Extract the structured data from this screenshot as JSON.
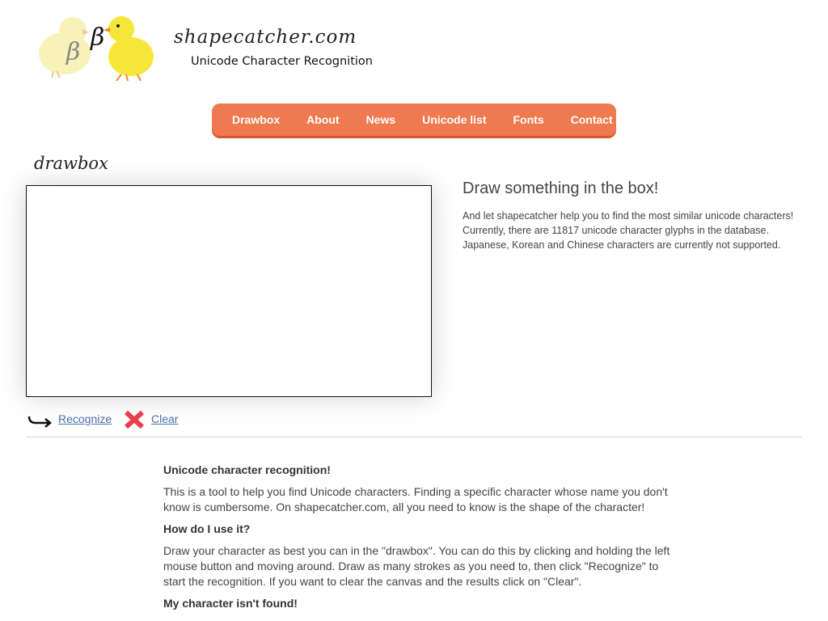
{
  "header": {
    "site_name": "shapecatcher.com",
    "tagline": "Unicode Character Recognition",
    "logo_glyph_left": "β",
    "logo_glyph_right": "β"
  },
  "nav": {
    "items": [
      {
        "label": "Drawbox"
      },
      {
        "label": "About"
      },
      {
        "label": "News"
      },
      {
        "label": "Unicode list"
      },
      {
        "label": "Fonts"
      },
      {
        "label": "Contact"
      }
    ],
    "color": "#f07a50"
  },
  "drawbox": {
    "title": "drawbox",
    "recognize_label": "Recognize",
    "clear_label": "Clear"
  },
  "info": {
    "heading": "Draw something in the box!",
    "line1": "And let shapecatcher help you to find the most similar unicode characters!",
    "line2": "Currently, there are 11817 unicode character glyphs in the database.",
    "line3": "Japanese, Korean and Chinese characters are currently not supported."
  },
  "article": {
    "h1": "Unicode character recognition!",
    "p1": "This is a tool to help you find Unicode characters. Finding a specific character whose name you don't know is cumbersome. On shapecatcher.com, all you need to know is the shape of the character!",
    "h2": "How do I use it?",
    "p2": "Draw your character as best you can in the \"drawbox\". You can do this by clicking and holding the left mouse button and moving around. Draw as many strokes as you need to, then click \"Recognize\" to start the recognition. If you want to clear the canvas and the results click on \"Clear\".",
    "h3": "My character isn't found!"
  },
  "colors": {
    "link": "#4a6ea8",
    "clear_x": "#e8404a"
  }
}
